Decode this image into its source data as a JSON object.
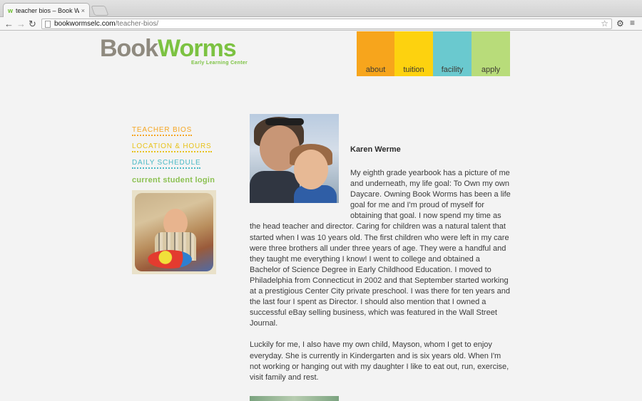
{
  "browser": {
    "tab_title": "teacher bios – Book Worms",
    "tab_close": "×",
    "back_glyph": "←",
    "forward_glyph": "→",
    "reload_glyph": "↻",
    "url_host": "bookwormselc.com",
    "url_path": "/teacher-bios/",
    "star_glyph": "☆",
    "wrench_glyph": "⚙",
    "menu_glyph": "≡"
  },
  "logo": {
    "word_part1": "Book",
    "word_part2": "Worms",
    "tagline": "Early Learning Center"
  },
  "nav": {
    "items": [
      "about",
      "tuition",
      "facility",
      "apply"
    ],
    "colors": [
      "#f7a51c",
      "#fdd20f",
      "#6ac9cf",
      "#b8dc7a"
    ]
  },
  "sidebar": {
    "links": [
      "TEACHER BIOS",
      "LOCATION & HOURS",
      "DAILY SCHEDULE"
    ],
    "login_heading": "current student login"
  },
  "bio": {
    "name": "Karen Werme",
    "para1_top": "My eighth grade yearbook has a picture of me and underneath, my life goal: To Own my own Daycare.  Owning Book Worms has been a life goal for me and I'm proud of myself for obtaining that goal.  I now spend my time as",
    "para1_rest": "the head teacher and director.  Caring for children was a natural talent that started when I was 10 years old.  The first children who were left in my care were three brothers all under three years of age.  They were a handful and they taught me everything I know!  I went to college and obtained a Bachelor of Science Degree in Early Childhood Education.  I moved to Philadelphia from Connecticut in 2002 and that September started working at a prestigious Center City private preschool.  I was there for ten years and the last four I spent as Director.  I should also mention that I owned a successful eBay selling business, which was featured in the Wall Street Journal.",
    "para2": "Luckily for me, I also have my own child, Mayson, whom I get to enjoy everyday.  She is currently in Kindergarten and is six years old.  When I'm not working or hanging out with my daughter I like to eat out, run, exercise, visit family and rest."
  }
}
